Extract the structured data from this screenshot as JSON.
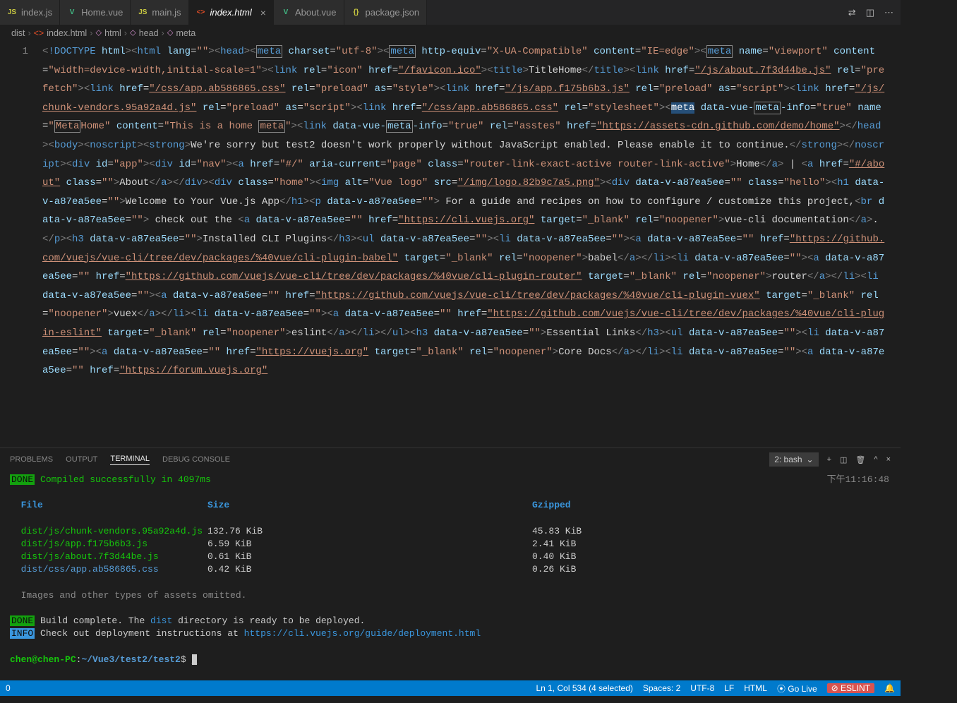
{
  "tabs": [
    {
      "icon": "JS",
      "iconClass": "ic-js",
      "label": "index.js"
    },
    {
      "icon": "V",
      "iconClass": "ic-vue",
      "label": "Home.vue"
    },
    {
      "icon": "JS",
      "iconClass": "ic-js",
      "label": "main.js"
    },
    {
      "icon": "<>",
      "iconClass": "ic-html",
      "label": "index.html",
      "active": true
    },
    {
      "icon": "V",
      "iconClass": "ic-vue",
      "label": "About.vue"
    },
    {
      "icon": "{}",
      "iconClass": "ic-json",
      "label": "package.json"
    }
  ],
  "breadcrumb": [
    "dist",
    "index.html",
    "html",
    "head",
    "meta"
  ],
  "gutter_line": "1",
  "terminal": {
    "select": "2: bash",
    "done_label": "DONE",
    "info_label": "INFO",
    "compiled": " Compiled successfully in 4097ms",
    "time": "下午11:16:48",
    "headers": {
      "file": "File",
      "size": "Size",
      "gzipped": "Gzipped"
    },
    "files": [
      {
        "name": "dist/js/chunk-vendors.95a92a4d.js",
        "size": "132.76 KiB",
        "gz": "45.83 KiB",
        "cls": "tgrn"
      },
      {
        "name": "dist/js/app.f175b6b3.js",
        "size": "6.59 KiB",
        "gz": "2.41 KiB",
        "cls": "tgrn"
      },
      {
        "name": "dist/js/about.7f3d44be.js",
        "size": "0.61 KiB",
        "gz": "0.40 KiB",
        "cls": "tgrn"
      },
      {
        "name": "dist/css/app.ab586865.css",
        "size": "0.42 KiB",
        "gz": "0.26 KiB",
        "cls": "tblu"
      }
    ],
    "omitted": "Images and other types of assets omitted.",
    "build": " Build complete. The ",
    "dist_word": "dist",
    "build2": " directory is ready to be deployed.",
    "info_text": " Check out deployment instructions at ",
    "info_url": "https://cli.vuejs.org/guide/deployment.html",
    "prompt_user": "chen@chen-PC",
    "prompt_path": "~/Vue3/test2/test2",
    "prompt_sym": "$"
  },
  "panel_tabs": [
    "PROBLEMS",
    "OUTPUT",
    "TERMINAL",
    "DEBUG CONSOLE"
  ],
  "status": {
    "left": "0",
    "pos": "Ln 1, Col 534 (4 selected)",
    "spaces": "Spaces: 2",
    "enc": "UTF-8",
    "eol": "LF",
    "lang": "HTML",
    "golive": "⦿ Go Live",
    "eslint": "⊘ ESLINT",
    "bell": "🔔"
  }
}
